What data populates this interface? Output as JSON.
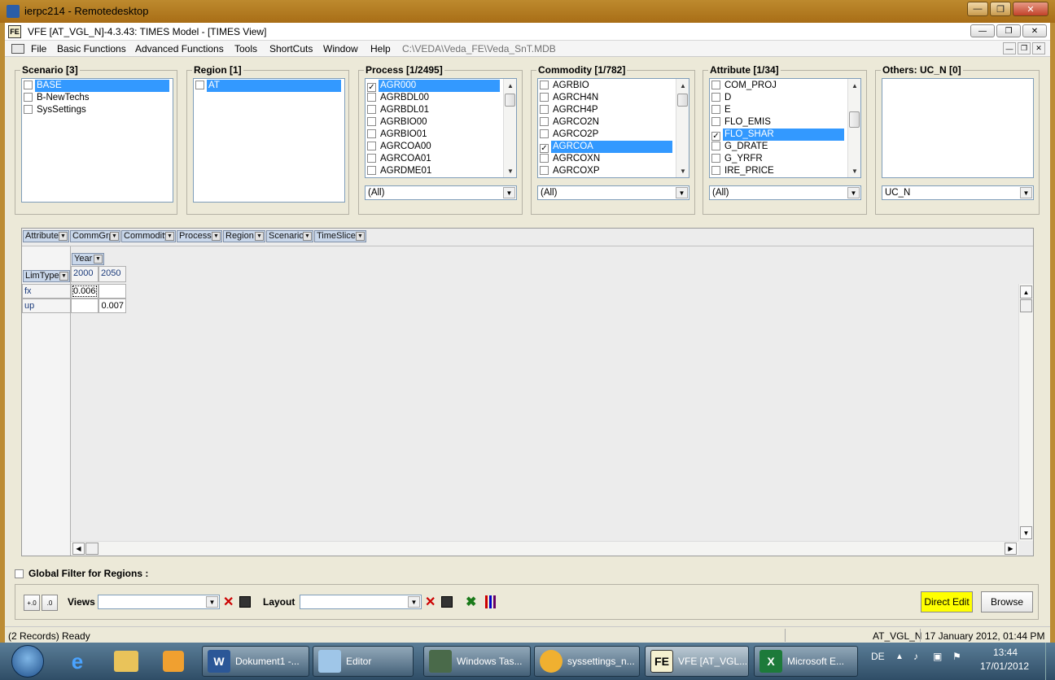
{
  "window": {
    "title": "ierpc214 - Remotedesktop"
  },
  "app": {
    "title": "VFE [AT_VGL_N]-4.3.43: TIMES Model - [TIMES View]",
    "icon_text": "FE",
    "menu": [
      "File",
      "Basic Functions",
      "Advanced Functions",
      "Tools",
      "ShortCuts",
      "Window",
      "Help"
    ],
    "path": "C:\\VEDA\\Veda_FE\\Veda_SnT.MDB"
  },
  "filters": {
    "scenario": {
      "caption": "Scenario [3]",
      "items": [
        {
          "label": "BASE",
          "checked": false,
          "selected": true
        },
        {
          "label": "B-NewTechs",
          "checked": false,
          "selected": false
        },
        {
          "label": "SysSettings",
          "checked": false,
          "selected": false
        }
      ]
    },
    "region": {
      "caption": "Region [1]",
      "items": [
        {
          "label": "AT",
          "checked": false,
          "selected": true
        }
      ]
    },
    "process": {
      "caption": "Process [1/2495]",
      "combo": "(All)",
      "items": [
        {
          "label": "AGR000",
          "checked": true,
          "selected": true
        },
        {
          "label": "AGRBDL00",
          "checked": false,
          "selected": false
        },
        {
          "label": "AGRBDL01",
          "checked": false,
          "selected": false
        },
        {
          "label": "AGRBIO00",
          "checked": false,
          "selected": false
        },
        {
          "label": "AGRBIO01",
          "checked": false,
          "selected": false
        },
        {
          "label": "AGRCOA00",
          "checked": false,
          "selected": false
        },
        {
          "label": "AGRCOA01",
          "checked": false,
          "selected": false
        },
        {
          "label": "AGRDME01",
          "checked": false,
          "selected": false
        }
      ]
    },
    "commodity": {
      "caption": "Commodity [1/782]",
      "combo": "(All)",
      "items": [
        {
          "label": "AGRBIO",
          "checked": false,
          "selected": false
        },
        {
          "label": "AGRCH4N",
          "checked": false,
          "selected": false
        },
        {
          "label": "AGRCH4P",
          "checked": false,
          "selected": false
        },
        {
          "label": "AGRCO2N",
          "checked": false,
          "selected": false
        },
        {
          "label": "AGRCO2P",
          "checked": false,
          "selected": false
        },
        {
          "label": "AGRCOA",
          "checked": true,
          "selected": true
        },
        {
          "label": "AGRCOXN",
          "checked": false,
          "selected": false
        },
        {
          "label": "AGRCOXP",
          "checked": false,
          "selected": false
        }
      ]
    },
    "attribute": {
      "caption": "Attribute [1/34]",
      "combo": "(All)",
      "items": [
        {
          "label": "COM_PROJ",
          "checked": false,
          "selected": false
        },
        {
          "label": "D",
          "checked": false,
          "selected": false
        },
        {
          "label": "E",
          "checked": false,
          "selected": false
        },
        {
          "label": "FLO_EMIS",
          "checked": false,
          "selected": false
        },
        {
          "label": "FLO_SHAR",
          "checked": true,
          "selected": true
        },
        {
          "label": "G_DRATE",
          "checked": false,
          "selected": false
        },
        {
          "label": "G_YRFR",
          "checked": false,
          "selected": false
        },
        {
          "label": "IRE_PRICE",
          "checked": false,
          "selected": false
        }
      ]
    },
    "others": {
      "caption": "Others: UC_N [0]",
      "combo": "UC_N",
      "items": []
    }
  },
  "pivot": {
    "fields": [
      "Attribute",
      "CommGrp",
      "Commodity",
      "Process",
      "Region",
      "Scenario",
      "TimeSlice"
    ],
    "col_field": "Year",
    "row_field": "LimType",
    "years": [
      "2000",
      "2050"
    ],
    "rows": [
      {
        "label": "fx",
        "values": [
          "0.006",
          ""
        ]
      },
      {
        "label": "up",
        "values": [
          "",
          "0.007"
        ]
      }
    ]
  },
  "bottom": {
    "global_filter_label": "Global Filter for Regions :",
    "views_label": "Views",
    "layout_label": "Layout",
    "direct_edit": "Direct Edit",
    "browse": "Browse"
  },
  "status": {
    "left": "(2 Records) Ready",
    "model": "AT_VGL_N",
    "datetime": "17 January 2012, 01:44 PM"
  },
  "taskbar": {
    "tasks": [
      "Dokument1 -...",
      "Editor",
      "Windows Tas...",
      "syssettings_n...",
      "VFE [AT_VGL...",
      "Microsoft E..."
    ],
    "lang": "DE",
    "time": "13:44",
    "date": "17/01/2012"
  }
}
